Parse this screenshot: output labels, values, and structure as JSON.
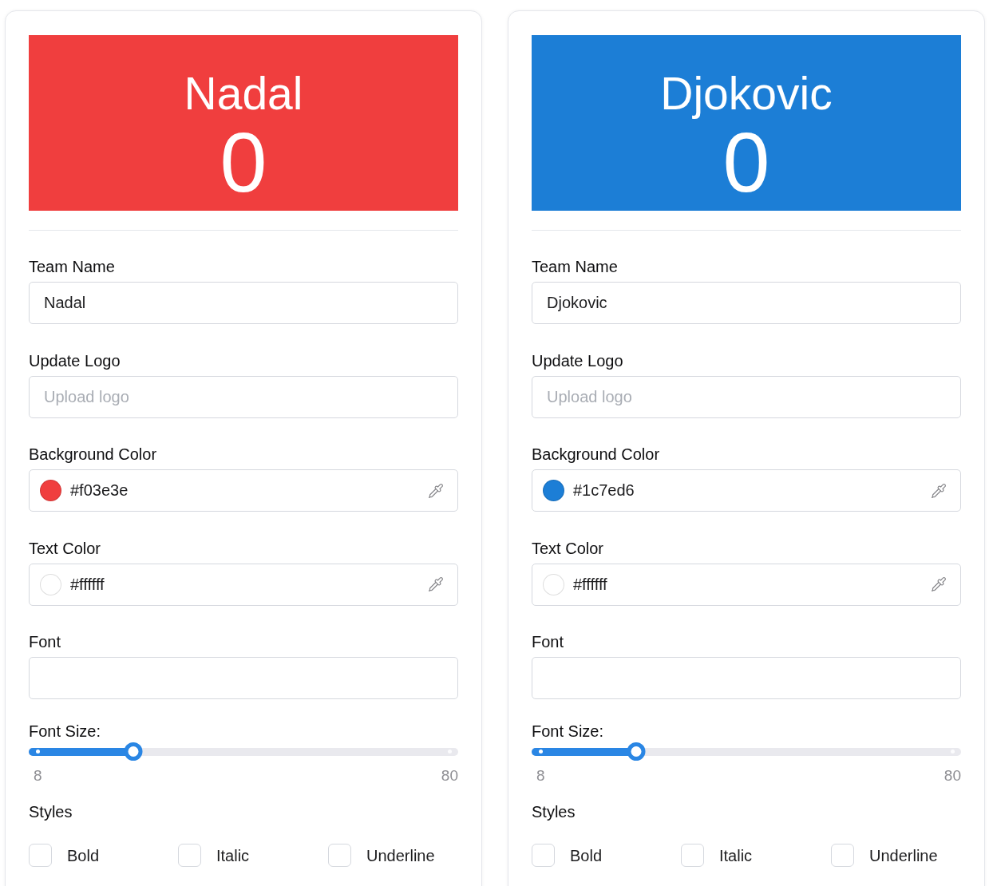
{
  "panels": [
    {
      "preview": {
        "name": "Nadal",
        "score": "0"
      },
      "fields": [
        {
          "kind": "text",
          "label": "Team Name",
          "value": "Nadal"
        },
        {
          "kind": "text",
          "label": "Update Logo",
          "placeholder": "Upload logo"
        },
        {
          "kind": "color",
          "label": "Background Color",
          "value": "#f03e3e",
          "color": "#f03e3e"
        },
        {
          "kind": "color",
          "label": "Text Color",
          "value": "#ffffff",
          "color": "#ffffff"
        },
        {
          "kind": "text",
          "label": "Font"
        },
        {
          "kind": "slider",
          "label": "Font Size:",
          "level": 0.243,
          "min_label": "8",
          "max_label": "80"
        },
        {
          "kind": "checkboxes",
          "label": "Styles",
          "options": [
            {
              "label": "Bold",
              "checked": false
            },
            {
              "label": "Italic",
              "checked": false
            },
            {
              "label": "Underline",
              "checked": false
            }
          ]
        }
      ]
    },
    {
      "preview": {
        "name": "Djokovic",
        "score": "0"
      },
      "fields": [
        {
          "kind": "text",
          "label": "Team Name",
          "value": "Djokovic"
        },
        {
          "kind": "text",
          "label": "Update Logo",
          "placeholder": "Upload logo"
        },
        {
          "kind": "color",
          "label": "Background Color",
          "value": "#1c7ed6",
          "color": "#1c7ed6"
        },
        {
          "kind": "color",
          "label": "Text Color",
          "value": "#ffffff",
          "color": "#ffffff"
        },
        {
          "kind": "text",
          "label": "Font"
        },
        {
          "kind": "slider",
          "label": "Font Size:",
          "level": 0.243,
          "min_label": "8",
          "max_label": "80"
        },
        {
          "kind": "checkboxes",
          "label": "Styles",
          "options": [
            {
              "label": "Bold",
              "checked": false
            },
            {
              "label": "Italic",
              "checked": false
            },
            {
              "label": "Underline",
              "checked": false
            }
          ]
        }
      ]
    }
  ]
}
